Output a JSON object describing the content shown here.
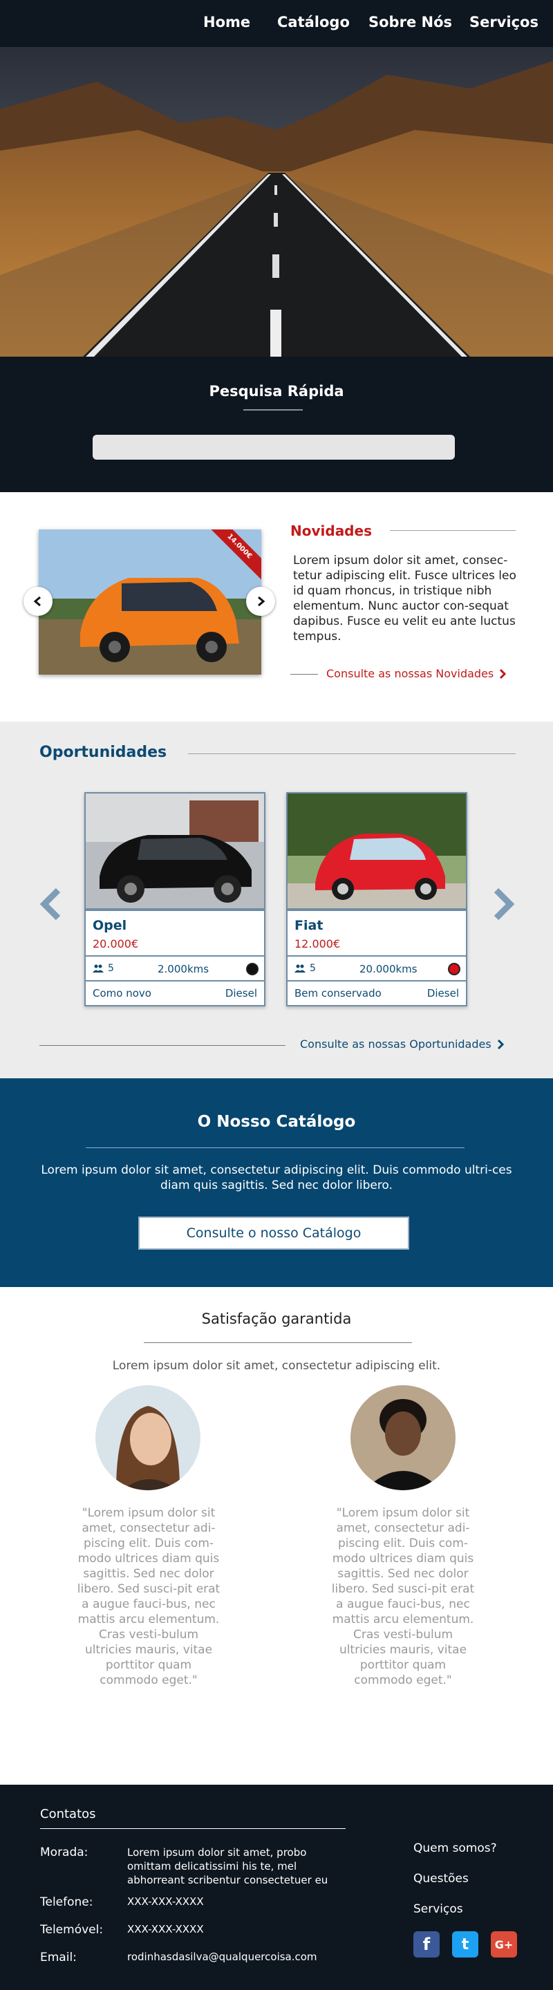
{
  "nav": {
    "items": [
      "Home",
      "Catálogo",
      "Sobre Nós",
      "Serviços"
    ]
  },
  "search": {
    "title": "Pesquisa Rápida",
    "placeholder": ""
  },
  "news": {
    "price_tag": "14.000€",
    "title": "Novidades",
    "text": "Lorem ipsum dolor sit amet, consec-tetur adipiscing elit. Fusce ultrices leo id quam rhoncus, in tristique nibh elementum. Nunc auctor con-sequat dapibus. Fusce eu velit eu ante luctus tempus.",
    "link": "Consulte as nossas Novidades"
  },
  "opportunities": {
    "title": "Oportunidades",
    "cards": [
      {
        "brand": "Opel",
        "price": "20.000€",
        "seats": "5",
        "kms": "2.000kms",
        "condition": "Como novo",
        "fuel": "Diesel",
        "color": "#111111"
      },
      {
        "brand": "Fiat",
        "price": "12.000€",
        "seats": "5",
        "kms": "20.000kms",
        "condition": "Bem conservado",
        "fuel": "Diesel",
        "color": "#d4121b"
      }
    ],
    "link": "Consulte as nossas Oportunidades"
  },
  "catalog": {
    "title": "O Nosso Catálogo",
    "text": "Lorem ipsum dolor sit amet, consectetur adipiscing elit. Duis commodo ultri-ces diam quis sagittis. Sed nec dolor libero.",
    "button": "Consulte o nosso Catálogo"
  },
  "testimonials": {
    "title": "Satisfação garantida",
    "subtitle": "Lorem ipsum dolor sit amet, consectetur adipiscing elit.",
    "quotes": [
      "\"Lorem ipsum dolor sit amet, consectetur adi-piscing elit. Duis com-modo ultrices diam quis sagittis. Sed nec dolor libero. Sed susci-pit erat a augue fauci-bus, nec mattis arcu elementum. Cras vesti-bulum ultricies mauris, vitae porttitor quam commodo eget.\"",
      "\"Lorem ipsum dolor sit amet, consectetur adi-piscing elit. Duis com-modo ultrices diam quis sagittis. Sed nec dolor libero. Sed susci-pit erat a augue fauci-bus, nec mattis arcu elementum. Cras vesti-bulum ultricies mauris, vitae porttitor quam commodo eget.\""
    ]
  },
  "footer": {
    "title": "Contatos",
    "morada_label": "Morada:",
    "morada_value": "Lorem ipsum dolor sit amet, probo omittam delicatissimi his te, mel abhorreant scribentur consectetuer eu",
    "telefone_label": "Telefone:",
    "telefone_value": "XXX-XXX-XXXX",
    "telemovel_label": "Telemóvel:",
    "telemovel_value": "XXX-XXX-XXXX",
    "email_label": "Email:",
    "email_value": "rodinhasdasilva@qualquercoisa.com",
    "links": [
      "Quem somos?",
      "Questões",
      "Serviços"
    ],
    "social": {
      "facebook": "f",
      "twitter": "t",
      "google_plus": "G+"
    }
  },
  "colors": {
    "dark": "#0e1620",
    "accent_red": "#c21a1a",
    "accent_blue": "#0c4a73",
    "catalog_bg": "#06466f"
  }
}
